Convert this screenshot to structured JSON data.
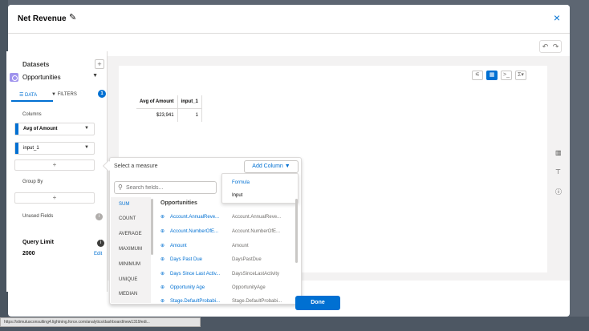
{
  "header": {
    "title": "Net Revenue",
    "close_label": "×"
  },
  "undo": {
    "undo": "↶",
    "redo": "↷"
  },
  "left_panel": {
    "datasets_title": "Datasets",
    "dataset_name": "Opportunities",
    "tabs": {
      "data": "DATA",
      "filters": "FILTERS",
      "filters_count": "1"
    },
    "columns_title": "Columns",
    "columns": [
      "Avg of Amount",
      "input_1"
    ],
    "group_by_title": "Group By",
    "unused_fields_title": "Unused Fields",
    "query_limit_title": "Query Limit",
    "query_limit_value": "2000",
    "edit_label": "Edit"
  },
  "table": {
    "headers": [
      "Avg of Amount",
      "input_1"
    ],
    "row": [
      "$23,941",
      "1"
    ]
  },
  "popover": {
    "select_measure": "Select a measure",
    "add_column_label": "Add Column",
    "dropdown_options": [
      "Formula",
      "Input"
    ],
    "search_placeholder": "Search fields...",
    "aggregations": [
      "SUM",
      "COUNT",
      "AVERAGE",
      "MAXIMUM",
      "MINIMUM",
      "UNIQUE",
      "MEDIAN"
    ],
    "fields_header": "Opportunities",
    "fields": [
      {
        "name": "Account.AnnualReve...",
        "api": "Account.AnnualReve..."
      },
      {
        "name": "Account.NumberOfE...",
        "api": "Account.NumberOfE..."
      },
      {
        "name": "Amount",
        "api": "Amount"
      },
      {
        "name": "Days Past Due",
        "api": "DaysPastDue"
      },
      {
        "name": "Days Since Last Activ...",
        "api": "DaysSinceLastActivity"
      },
      {
        "name": "Opportunity Age",
        "api": "OpportunityAge"
      },
      {
        "name": "Stage.DefaultProbabi...",
        "api": "Stage.DefaultProbabi..."
      }
    ]
  },
  "done_label": "Done",
  "status_url": "https://stimulusconsulting4.lightning.force.com/analytics/dashboard/new1319/edi..."
}
